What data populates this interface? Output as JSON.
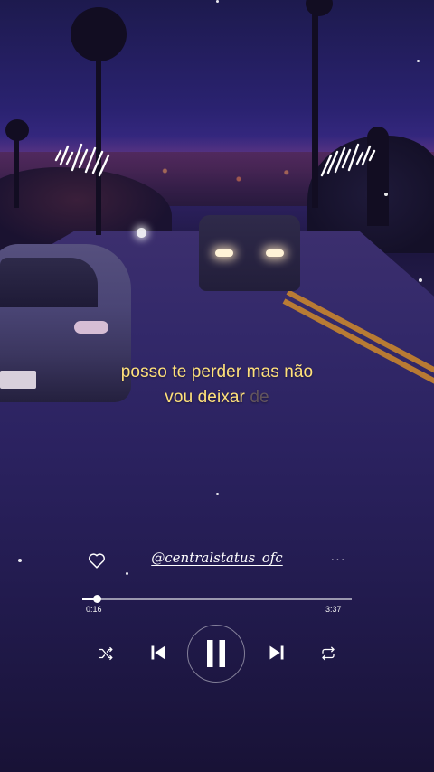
{
  "lyrics": {
    "line1": "posso te perder mas não",
    "line2_visible": "vou deixar",
    "line2_faded": "de"
  },
  "player": {
    "channel": "@centralstatus_ofc",
    "more_glyph": "···",
    "time_current": "0:16",
    "time_total": "3:37",
    "progress_fraction": 0.054,
    "state": "playing"
  },
  "icons": {
    "like": "heart-icon",
    "more": "more-options-icon",
    "shuffle": "shuffle-icon",
    "previous": "skip-previous-icon",
    "play_pause": "pause-icon",
    "next": "skip-next-icon",
    "repeat": "repeat-icon",
    "waveform": "sound-wave-icon"
  },
  "colors": {
    "lyric": "#ffe17a",
    "control": "#ffffff",
    "background": "#211a4c"
  }
}
